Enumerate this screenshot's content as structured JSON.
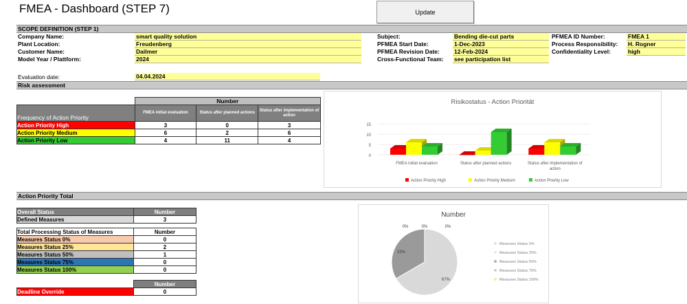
{
  "window": {
    "title": "FMEA - Dashboard (STEP 7)",
    "update_label": "Update"
  },
  "scope": {
    "section_title": "SCOPE DEFINITION (STEP 1)",
    "company_label": "Company Name:",
    "company_value": "smart quality solution",
    "plant_label": "Plant Location:",
    "plant_value": "Freudenberg",
    "customer_label": "Customer Name:",
    "customer_value": "Dailmer",
    "model_label": "Model Year / Plattform:",
    "model_value": "2024",
    "subject_label": "Subject:",
    "subject_value": "Bending die-cut parts",
    "start_label": "PFMEA Start Date:",
    "start_value": "1-Dec-2023",
    "revision_label": "PFMEA Revision Date:",
    "revision_value": "12-Feb-2024",
    "team_label": "Cross-Functional Team:",
    "team_value": "see participation list",
    "id_label": "PFMEA ID Number:",
    "id_value": "FMEA 1",
    "resp_label": "Process Responsibility:",
    "resp_value": "H. Rogner",
    "conf_label": "Confidentiality Level:",
    "conf_value": "high"
  },
  "evaluation": {
    "label": "Evaluation date:",
    "value": "04.04.2024"
  },
  "risk": {
    "section_title": "Risk assessment",
    "number_header": "Number",
    "freq_header": "Frequency of Action Priority",
    "col_headers": [
      "FMEA initial evaluation",
      "Status after planned actions",
      "Status after implementation of action"
    ],
    "rows": [
      {
        "label": "Action Priority High",
        "values": [
          "3",
          "0",
          "3"
        ]
      },
      {
        "label": "Action Priority Medium",
        "values": [
          "6",
          "2",
          "6"
        ]
      },
      {
        "label": "Action Priority Low",
        "values": [
          "4",
          "11",
          "4"
        ]
      }
    ]
  },
  "priority_total": {
    "section_title": "Action Priority Total",
    "overall_header": "Overall Status",
    "overall_number": "Number",
    "defined_label": "Defined Measures",
    "defined_value": "3",
    "processing_header": "Total Processing Status of Measures",
    "processing_number": "Number",
    "status_rows": [
      {
        "label": "Measures Status 0%",
        "value": "0"
      },
      {
        "label": "Measures Status 25%",
        "value": "2"
      },
      {
        "label": "Measures Status 50%",
        "value": "1"
      },
      {
        "label": "Measures Status 75%",
        "value": "0"
      },
      {
        "label": "Measures Status 100%",
        "value": "0"
      }
    ],
    "deadline_number_header": "Number",
    "deadline_label": "Deadline Override",
    "deadline_value": "0"
  },
  "colors": {
    "high": "#ff0000",
    "medium": "#ffff00",
    "low": "#33cc33",
    "status0": "#f8cbad",
    "status25": "#ffe699",
    "status50": "#bfbfbf",
    "status75": "#2e75b6",
    "status100": "#92d050"
  },
  "chart_data": [
    {
      "type": "bar",
      "title": "Risikostatus - Action Priorität",
      "categories": [
        "FMEA initial evaluation",
        "Status after planned actions",
        "Status after implementation of action"
      ],
      "series": [
        {
          "name": "Action Priority High",
          "values": [
            3,
            0,
            3
          ],
          "color": "#ff0000"
        },
        {
          "name": "Action Priority Medium",
          "values": [
            6,
            2,
            6
          ],
          "color": "#ffff00"
        },
        {
          "name": "Action Priority Low",
          "values": [
            4,
            11,
            4
          ],
          "color": "#33cc33"
        }
      ],
      "yticks": [
        "0",
        "5",
        "10",
        "15"
      ],
      "ylim": [
        0,
        15
      ],
      "legend": "bottom"
    },
    {
      "type": "pie",
      "title": "Number",
      "labels": [
        "Measures Status 0%",
        "Measures Status 25%",
        "Measures Status 50%",
        "Measures Status 75%",
        "Measures Status 100%"
      ],
      "values": [
        0,
        2,
        1,
        0,
        0
      ],
      "percent_labels": [
        "0%",
        "67%",
        "33%",
        "0%",
        "0%"
      ],
      "colors": [
        "#e6e6e6",
        "#d9d9d9",
        "#9a9a9a",
        "#cfcfcf",
        "#e0e0e0"
      ],
      "legend": "right"
    }
  ]
}
